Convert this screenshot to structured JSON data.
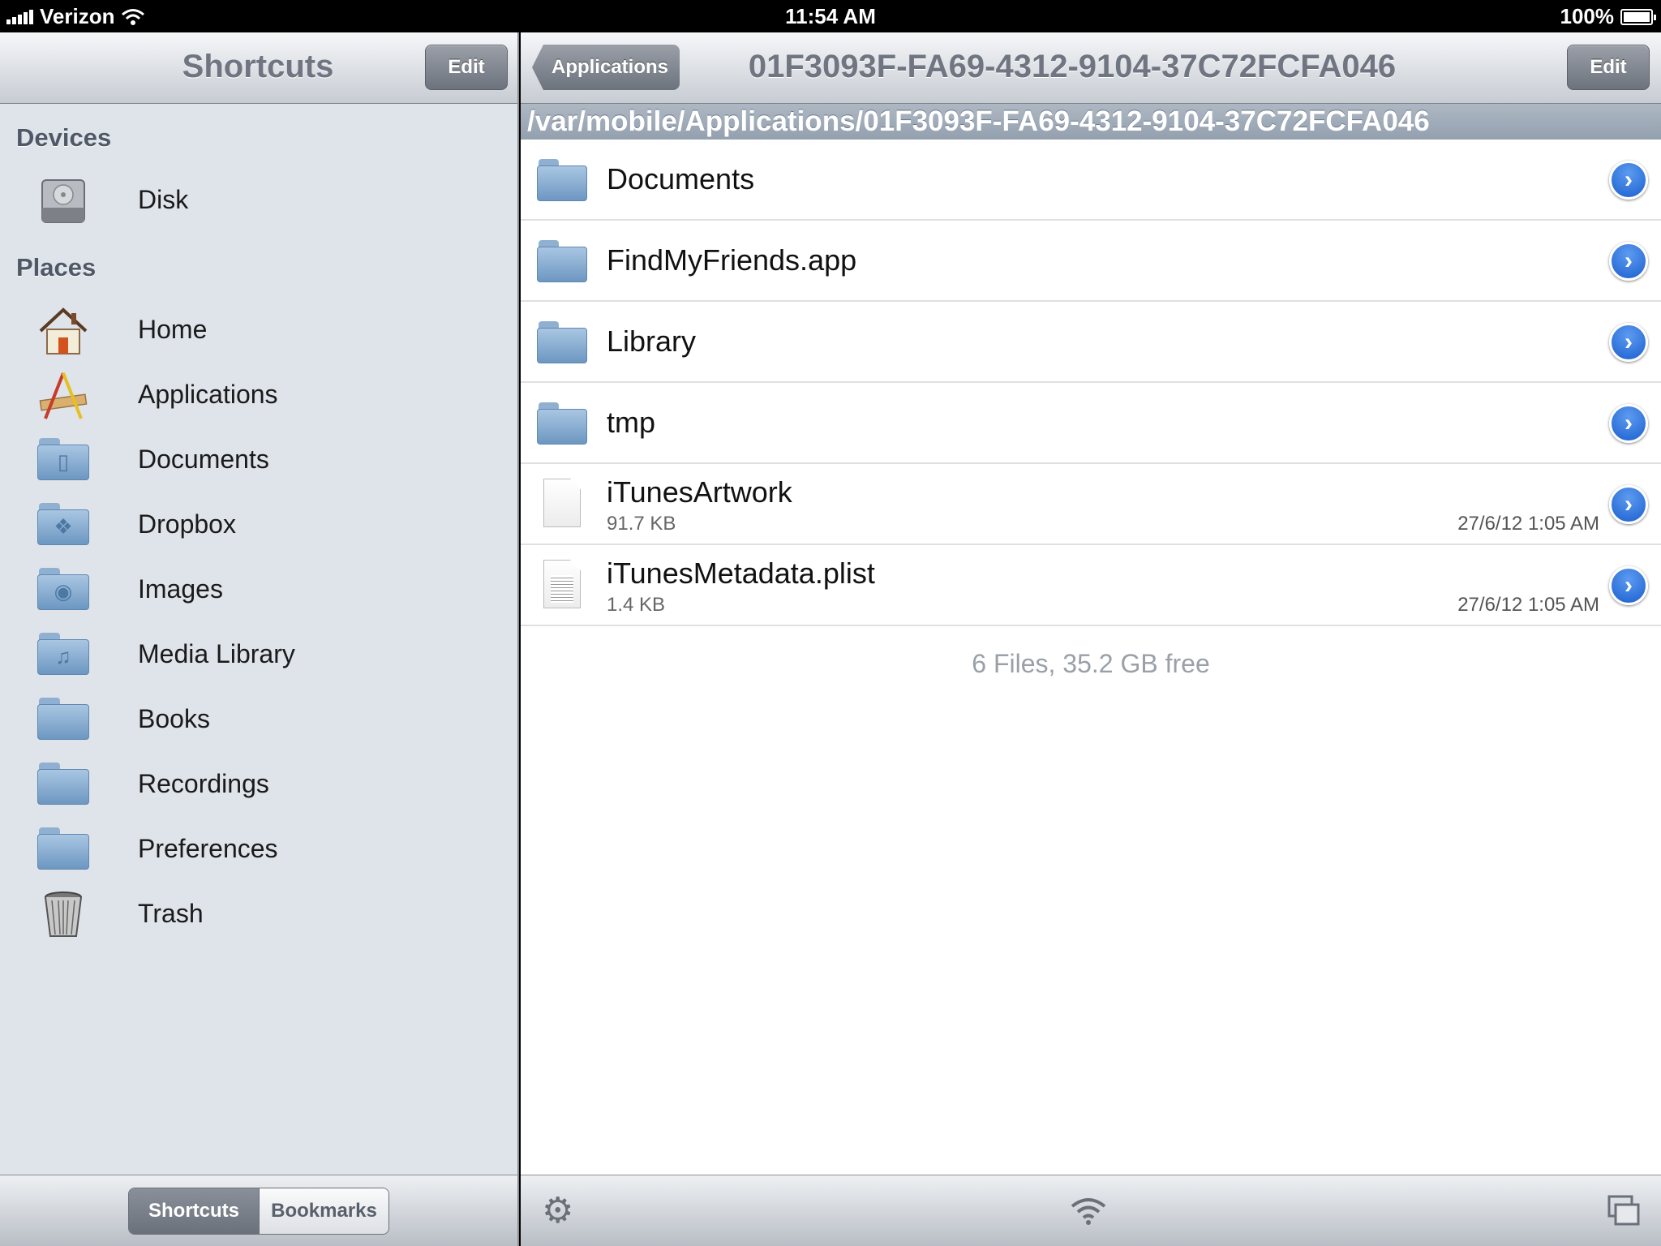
{
  "status": {
    "carrier": "Verizon",
    "time": "11:54 AM",
    "battery": "100%"
  },
  "sidebar": {
    "title": "Shortcuts",
    "edit_label": "Edit",
    "devices_heading": "Devices",
    "devices": [
      {
        "label": "Disk",
        "icon": "disk-icon"
      }
    ],
    "places_heading": "Places",
    "places": [
      {
        "label": "Home",
        "icon": "home-icon"
      },
      {
        "label": "Applications",
        "icon": "applications-icon"
      },
      {
        "label": "Documents",
        "icon": "documents-folder-icon"
      },
      {
        "label": "Dropbox",
        "icon": "dropbox-folder-icon"
      },
      {
        "label": "Images",
        "icon": "images-folder-icon"
      },
      {
        "label": "Media Library",
        "icon": "music-folder-icon"
      },
      {
        "label": "Books",
        "icon": "folder-icon"
      },
      {
        "label": "Recordings",
        "icon": "folder-icon"
      },
      {
        "label": "Preferences",
        "icon": "folder-icon"
      },
      {
        "label": "Trash",
        "icon": "trash-icon"
      }
    ],
    "segments": [
      {
        "label": "Shortcuts",
        "selected": true
      },
      {
        "label": "Bookmarks",
        "selected": false
      }
    ]
  },
  "main": {
    "back_label": "Applications",
    "title": "01F3093F-FA69-4312-9104-37C72FCFA046",
    "edit_label": "Edit",
    "path": "/var/mobile/Applications/01F3093F-FA69-4312-9104-37C72FCFA046",
    "files": [
      {
        "name": "Documents",
        "type": "folder"
      },
      {
        "name": "FindMyFriends.app",
        "type": "folder"
      },
      {
        "name": "Library",
        "type": "folder"
      },
      {
        "name": "tmp",
        "type": "folder"
      },
      {
        "name": "iTunesArtwork",
        "type": "file",
        "size": "91.7 KB",
        "date": "27/6/12 1:05 AM"
      },
      {
        "name": "iTunesMetadata.plist",
        "type": "plist",
        "size": "1.4 KB",
        "date": "27/6/12 1:05 AM"
      }
    ],
    "summary": "6 Files, 35.2 GB free"
  },
  "toolbar": {
    "icons": [
      "settings-gear-icon",
      "wifi-icon",
      "windows-icon"
    ]
  }
}
